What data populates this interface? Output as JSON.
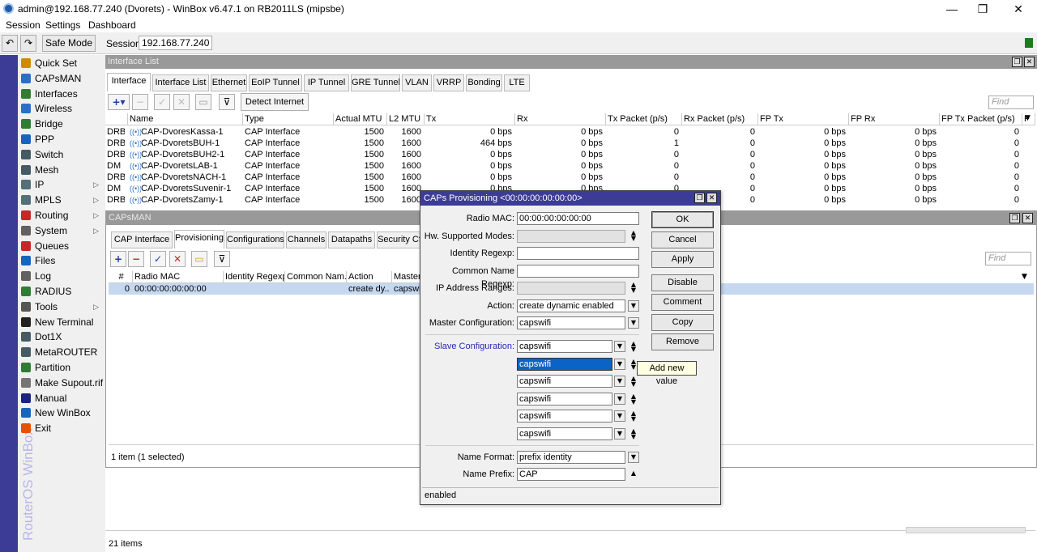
{
  "window": {
    "title": "admin@192.168.77.240 (Dvorets) - WinBox v6.47.1 on RB2011LS (mipsbe)",
    "minimize": "—",
    "maximize": "❐",
    "close": "✕"
  },
  "menu": [
    "Session",
    "Settings",
    "Dashboard"
  ],
  "toolbar": {
    "undo_icon": "↶",
    "redo_icon": "↷",
    "safe_mode": "Safe Mode",
    "session_label": "Session:",
    "session_value": "192.168.77.240"
  },
  "brand": "RouterOS WinBox",
  "sidebar": [
    {
      "label": "Quick Set",
      "icon": "quick-set-icon",
      "color": "#d08a00",
      "arrow": false
    },
    {
      "label": "CAPsMAN",
      "icon": "capsman-icon",
      "color": "#2a6fc9",
      "arrow": false
    },
    {
      "label": "Interfaces",
      "icon": "interfaces-icon",
      "color": "#2e7d32",
      "arrow": false
    },
    {
      "label": "Wireless",
      "icon": "wireless-icon",
      "color": "#2a6fc9",
      "arrow": false
    },
    {
      "label": "Bridge",
      "icon": "bridge-icon",
      "color": "#2e7d32",
      "arrow": false
    },
    {
      "label": "PPP",
      "icon": "ppp-icon",
      "color": "#1565c0",
      "arrow": false
    },
    {
      "label": "Switch",
      "icon": "switch-icon",
      "color": "#455a64",
      "arrow": false
    },
    {
      "label": "Mesh",
      "icon": "mesh-icon",
      "color": "#455a64",
      "arrow": false
    },
    {
      "label": "IP",
      "icon": "ip-icon",
      "color": "#546e7a",
      "arrow": true
    },
    {
      "label": "MPLS",
      "icon": "mpls-icon",
      "color": "#546e7a",
      "arrow": true
    },
    {
      "label": "Routing",
      "icon": "routing-icon",
      "color": "#c62828",
      "arrow": true
    },
    {
      "label": "System",
      "icon": "system-icon",
      "color": "#616161",
      "arrow": true
    },
    {
      "label": "Queues",
      "icon": "queues-icon",
      "color": "#c62828",
      "arrow": false
    },
    {
      "label": "Files",
      "icon": "files-icon",
      "color": "#1565c0",
      "arrow": false
    },
    {
      "label": "Log",
      "icon": "log-icon",
      "color": "#616161",
      "arrow": false
    },
    {
      "label": "RADIUS",
      "icon": "radius-icon",
      "color": "#2e7d32",
      "arrow": false
    },
    {
      "label": "Tools",
      "icon": "tools-icon",
      "color": "#555555",
      "arrow": true
    },
    {
      "label": "New Terminal",
      "icon": "terminal-icon",
      "color": "#212121",
      "arrow": false
    },
    {
      "label": "Dot1X",
      "icon": "dot1x-icon",
      "color": "#455a64",
      "arrow": false
    },
    {
      "label": "MetaROUTER",
      "icon": "metarouter-icon",
      "color": "#455a64",
      "arrow": false
    },
    {
      "label": "Partition",
      "icon": "partition-icon",
      "color": "#2e7d32",
      "arrow": false
    },
    {
      "label": "Make Supout.rif",
      "icon": "supout-icon",
      "color": "#757575",
      "arrow": false
    },
    {
      "label": "Manual",
      "icon": "manual-icon",
      "color": "#1a237e",
      "arrow": false
    },
    {
      "label": "New WinBox",
      "icon": "winbox-icon",
      "color": "#1565c0",
      "arrow": false
    },
    {
      "label": "Exit",
      "icon": "exit-icon",
      "color": "#e65100",
      "arrow": false
    }
  ],
  "interface_list": {
    "title": "Interface List",
    "tabs": [
      "Interface",
      "Interface List",
      "Ethernet",
      "EoIP Tunnel",
      "IP Tunnel",
      "GRE Tunnel",
      "VLAN",
      "VRRP",
      "Bonding",
      "LTE"
    ],
    "detect_internet": "Detect Internet",
    "find_placeholder": "Find",
    "columns": [
      "Name",
      "Type",
      "Actual MTU",
      "L2 MTU",
      "Tx",
      "Rx",
      "Tx Packet (p/s)",
      "Rx Packet (p/s)",
      "FP Tx",
      "FP Rx",
      "FP Tx Packet (p/s)",
      "F"
    ],
    "rows": [
      {
        "flags": "DRB",
        "name": "CAP-DvoresKassa-1",
        "type": "CAP Interface",
        "mtu": "1500",
        "l2": "1600",
        "tx": "0 bps",
        "rx": "0 bps",
        "txp": "0",
        "rxp": "0",
        "fptx": "0 bps",
        "fprx": "0 bps",
        "fptxp": "0"
      },
      {
        "flags": "DRB",
        "name": "CAP-DvoretsBUH-1",
        "type": "CAP Interface",
        "mtu": "1500",
        "l2": "1600",
        "tx": "464 bps",
        "rx": "0 bps",
        "txp": "1",
        "rxp": "0",
        "fptx": "0 bps",
        "fprx": "0 bps",
        "fptxp": "0"
      },
      {
        "flags": "DRB",
        "name": "CAP-DvoretsBUH2-1",
        "type": "CAP Interface",
        "mtu": "1500",
        "l2": "1600",
        "tx": "0 bps",
        "rx": "0 bps",
        "txp": "0",
        "rxp": "0",
        "fptx": "0 bps",
        "fprx": "0 bps",
        "fptxp": "0"
      },
      {
        "flags": "DM",
        "name": "CAP-DvoretsLAB-1",
        "type": "CAP Interface",
        "mtu": "1500",
        "l2": "1600",
        "tx": "0 bps",
        "rx": "0 bps",
        "txp": "0",
        "rxp": "0",
        "fptx": "0 bps",
        "fprx": "0 bps",
        "fptxp": "0"
      },
      {
        "flags": "DRB",
        "name": "CAP-DvoretsNACH-1",
        "type": "CAP Interface",
        "mtu": "1500",
        "l2": "1600",
        "tx": "0 bps",
        "rx": "0 bps",
        "txp": "0",
        "rxp": "0",
        "fptx": "0 bps",
        "fprx": "0 bps",
        "fptxp": "0"
      },
      {
        "flags": "DM",
        "name": "CAP-DvoretsSuvenir-1",
        "type": "CAP Interface",
        "mtu": "1500",
        "l2": "1600",
        "tx": "0 bps",
        "rx": "0 bps",
        "txp": "0",
        "rxp": "0",
        "fptx": "0 bps",
        "fprx": "0 bps",
        "fptxp": "0"
      },
      {
        "flags": "DRB",
        "name": "CAP-DvoretsZamy-1",
        "type": "CAP Interface",
        "mtu": "1500",
        "l2": "1600",
        "tx": "0 bps",
        "rx": "0 bps",
        "txp": "0",
        "rxp": "0",
        "fptx": "0 bps",
        "fprx": "0 bps",
        "fptxp": "0"
      }
    ],
    "status": "21 items"
  },
  "capsman": {
    "title": "CAPsMAN",
    "tabs": [
      "CAP Interface",
      "Provisioning",
      "Configurations",
      "Channels",
      "Datapaths",
      "Security Cf"
    ],
    "find_placeholder": "Find",
    "columns": [
      "#",
      "Radio MAC",
      "Identity Regexp",
      "Common Nam...",
      "Action",
      "Master"
    ],
    "rows": [
      {
        "num": "0",
        "mac": "00:00:00:00:00:00",
        "identity": "",
        "common": "",
        "action": "create dy...",
        "master": "capswi"
      }
    ],
    "status": "1 item (1 selected)"
  },
  "dialog": {
    "title": "CAPs Provisioning <00:00:00:00:00:00>",
    "fields": {
      "radio_mac_label": "Radio MAC:",
      "radio_mac": "00:00:00:00:00:00",
      "hw_modes_label": "Hw. Supported Modes:",
      "identity_label": "Identity Regexp:",
      "common_name_label": "Common Name Regexp:",
      "ip_ranges_label": "IP Address Ranges:",
      "action_label": "Action:",
      "action": "create dynamic enabled",
      "master_label": "Master Configuration:",
      "master": "capswifi",
      "slave_label": "Slave Configuration:",
      "slaves": [
        "capswifi",
        "capswifi",
        "capswifi",
        "capswifi",
        "capswifi",
        "capswifi"
      ],
      "name_format_label": "Name Format:",
      "name_format": "prefix identity",
      "name_prefix_label": "Name Prefix:",
      "name_prefix": "CAP"
    },
    "buttons": [
      "OK",
      "Cancel",
      "Apply",
      "Disable",
      "Comment",
      "Copy",
      "Remove"
    ],
    "status": "enabled",
    "tooltip": "Add new value",
    "link_color": "#2a2ab0"
  }
}
